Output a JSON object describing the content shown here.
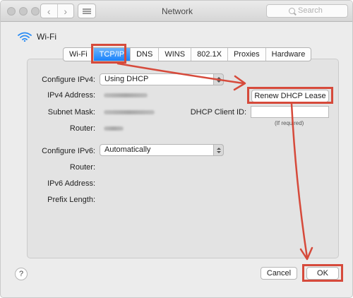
{
  "window": {
    "title": "Network"
  },
  "toolbar": {
    "back_glyph": "‹",
    "forward_glyph": "›",
    "search_placeholder": "Search"
  },
  "header": {
    "interface_name": "Wi-Fi"
  },
  "tabs": [
    {
      "label": "Wi-Fi",
      "selected": false
    },
    {
      "label": "TCP/IP",
      "selected": true
    },
    {
      "label": "DNS",
      "selected": false
    },
    {
      "label": "WINS",
      "selected": false
    },
    {
      "label": "802.1X",
      "selected": false
    },
    {
      "label": "Proxies",
      "selected": false
    },
    {
      "label": "Hardware",
      "selected": false
    }
  ],
  "ipv4": {
    "configure_label": "Configure IPv4:",
    "configure_value": "Using DHCP",
    "address_label": "IPv4 Address:",
    "subnet_label": "Subnet Mask:",
    "router_label": "Router:",
    "renew_button": "Renew DHCP Lease",
    "client_id_label": "DHCP Client ID:",
    "client_id_value": "",
    "client_id_hint": "(If required)"
  },
  "ipv6": {
    "configure_label": "Configure IPv6:",
    "configure_value": "Automatically",
    "router_label": "Router:",
    "address_label": "IPv6 Address:",
    "prefix_label": "Prefix Length:"
  },
  "footer": {
    "help_glyph": "?",
    "cancel_button": "Cancel",
    "ok_button": "OK"
  },
  "colors": {
    "annotation": "#d64a3b",
    "tab_selected": "#1a82fb",
    "wifi_icon": "#2b8df5"
  },
  "icons": {
    "wifi": "wifi-icon",
    "search": "search-icon",
    "help": "help-icon"
  }
}
